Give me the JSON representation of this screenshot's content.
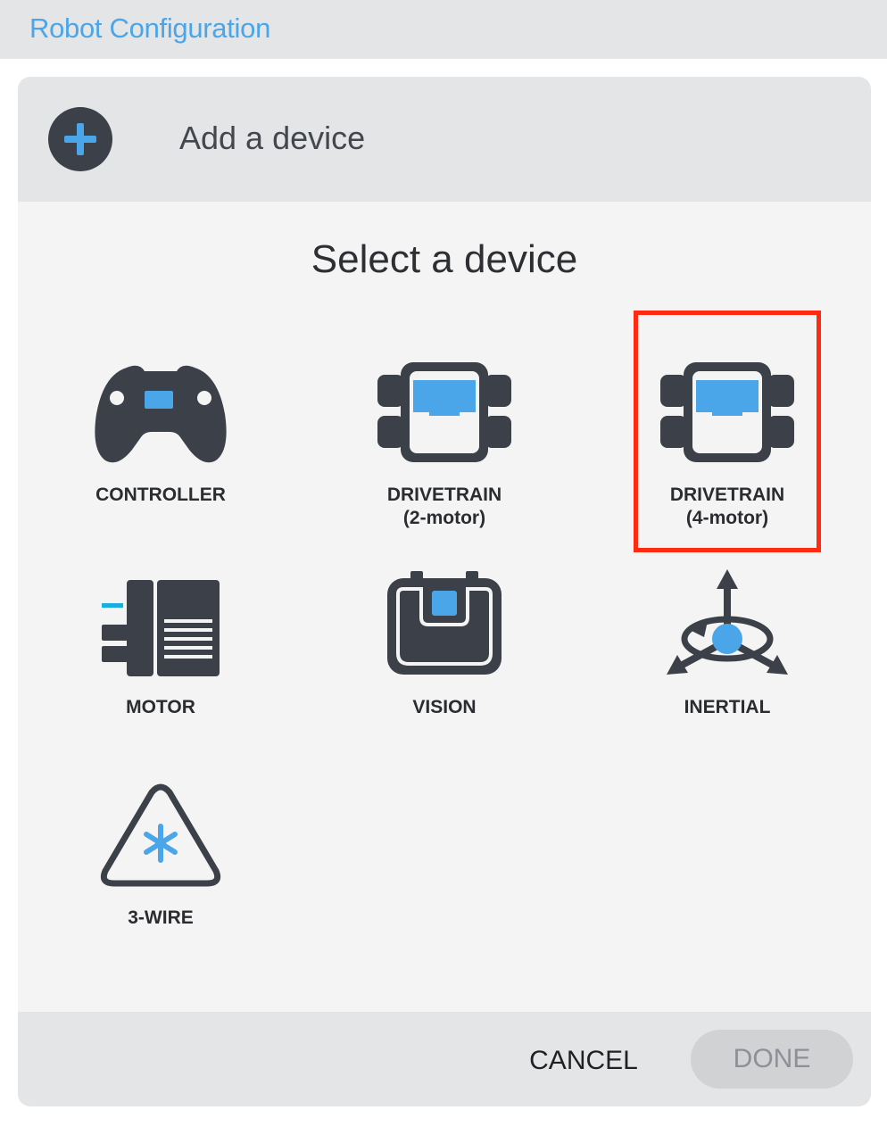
{
  "app": {
    "title": "Robot Configuration"
  },
  "dialog": {
    "header_label": "Add a device",
    "section_title": "Select a device",
    "devices": [
      {
        "id": "controller",
        "label_line1": "CONTROLLER",
        "label_line2": "",
        "icon": "controller-icon"
      },
      {
        "id": "drivetrain-2",
        "label_line1": "DRIVETRAIN",
        "label_line2": "(2-motor)",
        "icon": "drivetrain-2-motor-icon"
      },
      {
        "id": "drivetrain-4",
        "label_line1": "DRIVETRAIN",
        "label_line2": "(4-motor)",
        "icon": "drivetrain-4-motor-icon",
        "highlighted": true
      },
      {
        "id": "motor",
        "label_line1": "MOTOR",
        "label_line2": "",
        "icon": "motor-icon"
      },
      {
        "id": "vision",
        "label_line1": "VISION",
        "label_line2": "",
        "icon": "vision-sensor-icon"
      },
      {
        "id": "inertial",
        "label_line1": "INERTIAL",
        "label_line2": "",
        "icon": "inertial-sensor-icon"
      },
      {
        "id": "3-wire",
        "label_line1": "3-WIRE",
        "label_line2": "",
        "icon": "three-wire-icon"
      }
    ],
    "cancel_label": "CANCEL",
    "done_label": "DONE",
    "done_enabled": false
  },
  "colors": {
    "accent_blue": "#4aa6e8",
    "icon_dark": "#3c4048",
    "highlight_red": "#ff2a12",
    "dialog_bg": "#f4f4f4",
    "bar_bg": "#e4e5e7"
  }
}
